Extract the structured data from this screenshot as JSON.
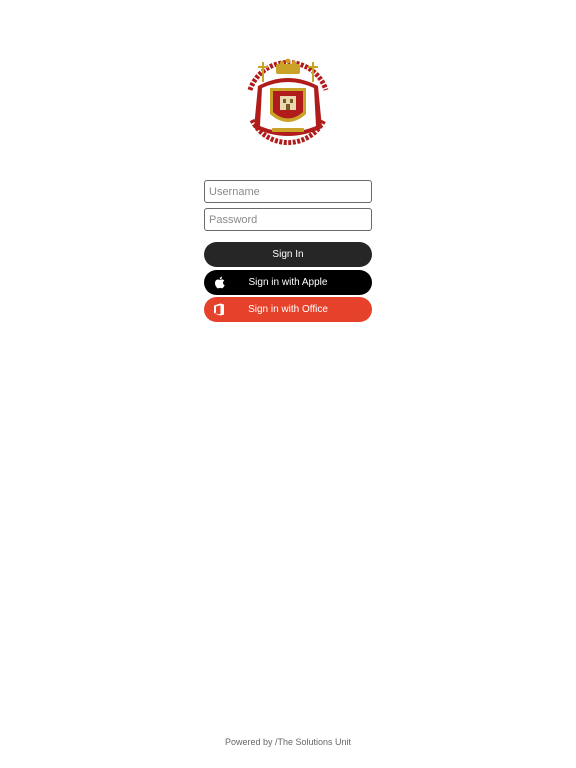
{
  "login": {
    "username_placeholder": "Username",
    "password_placeholder": "Password",
    "signin_label": "Sign In",
    "apple_label": "Sign in with Apple",
    "office_label": "Sign in with Office"
  },
  "footer": {
    "text": "Powered by /The Solutions Unit"
  },
  "colors": {
    "signin_bg": "#262626",
    "apple_bg": "#000000",
    "office_bg": "#e6412a",
    "logo_red": "#b01c1c",
    "logo_gold": "#c9a227"
  },
  "icons": {
    "apple": "apple-icon",
    "office": "office-icon"
  }
}
